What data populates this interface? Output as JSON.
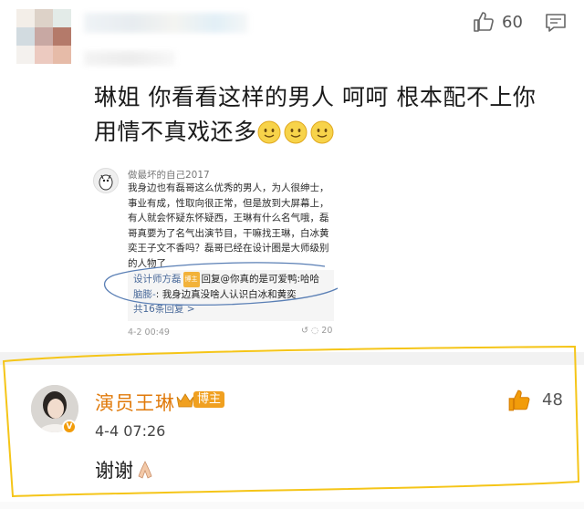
{
  "top_comment": {
    "like_count": "60",
    "text_line1": "琳姐 你看看这样的男人 呵呵 根本配不上你",
    "text_line2": "用情不真戏还多",
    "emoji_count": 3,
    "icons": {
      "like": "thumbs-up-outline-icon",
      "reply": "comment-bubble-icon",
      "smile": "smile-emoji-icon"
    }
  },
  "embedded_post": {
    "author": "做最坏的自己2017",
    "body": "我身边也有磊哥这么优秀的男人，为人很绅士，事业有成，性取向很正常，但是放到大屏幕上，有人就会怀疑东怀疑西，王琳有什么名气哦，磊哥真要为了名气出演节目，干嘛找王琳，白冰黄奕王子文不香吗？磊哥已经在设计圈是大师级别的人物了",
    "replies": [
      {
        "nick": "设计师方磊",
        "badge": "博主",
        "text": "回复@你真的是可爱鸭:哈哈"
      },
      {
        "nick": "脑膨-",
        "text": "我身边真没啥人认识白冰和黄奕"
      }
    ],
    "more": "共16条回复 >",
    "date": "4-2 00:49",
    "counts": "20"
  },
  "host_reply": {
    "name": "演员王琳",
    "badge": "博主",
    "date": "4-4 07:26",
    "text": "谢谢",
    "like_count": "48",
    "icons": {
      "like": "thumbs-up-filled-icon",
      "verified": "verified-v-icon",
      "crown": "crown-icon",
      "pray": "praying-hands-icon"
    },
    "highlight_color": "#f5c518"
  },
  "colors": {
    "name_orange": "#e07a0b",
    "badge_orange": "#f0a020",
    "highlight_yellow": "#f5c518"
  }
}
